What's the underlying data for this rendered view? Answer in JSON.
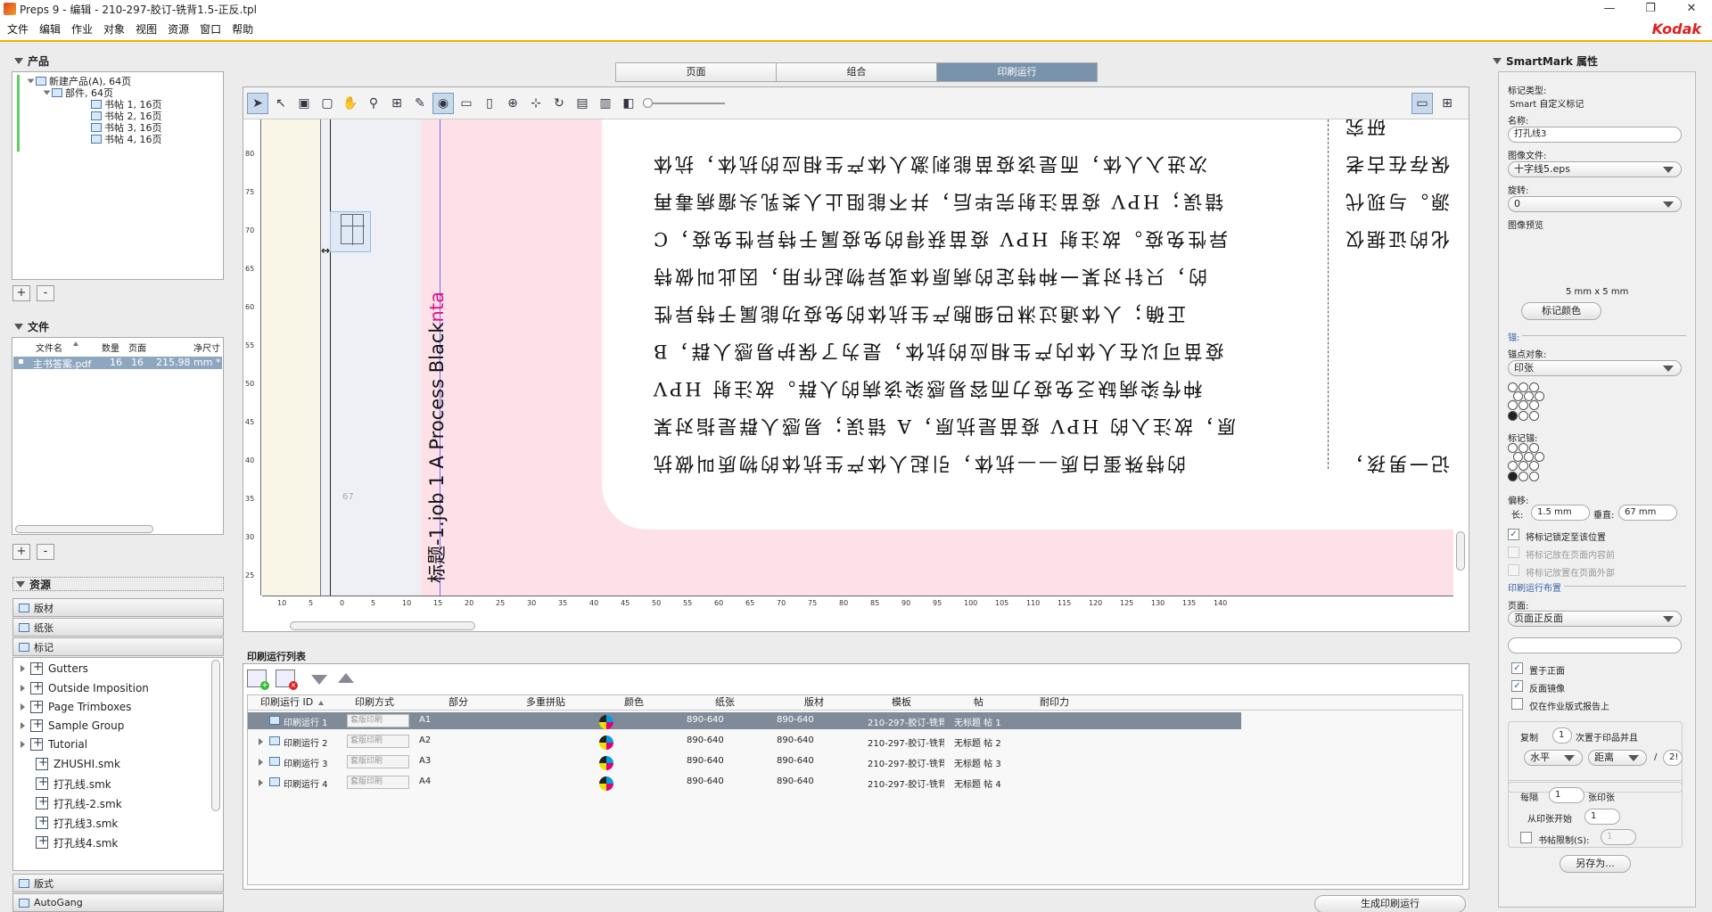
{
  "window": {
    "title": "Preps 9 - 编辑 - 210-297-胶订-铣背1.5-正反.tpl",
    "minimize": "—",
    "restore": "❐",
    "close": "✕"
  },
  "menu": [
    "文件",
    "编辑",
    "作业",
    "对象",
    "视图",
    "资源",
    "窗口",
    "帮助"
  ],
  "brand": "Kodak",
  "product_panel": {
    "title": "产品",
    "tree": [
      {
        "label": "新建产品(A), 64页",
        "level": 0
      },
      {
        "label": "部件, 64页",
        "level": 1
      },
      {
        "label": "书帖 1, 16页",
        "level": 2
      },
      {
        "label": "书帖 2, 16页",
        "level": 2
      },
      {
        "label": "书帖 3, 16页",
        "level": 2
      },
      {
        "label": "书帖 4, 16页",
        "level": 2
      }
    ],
    "add": "+",
    "remove": "-"
  },
  "files_panel": {
    "title": "文件",
    "columns": [
      "文件名",
      "数量",
      "页面",
      "净尺寸"
    ],
    "rows": [
      {
        "name": "主书答案.pdf",
        "qty": "16",
        "pages": "16",
        "size": "215.98 mm *"
      }
    ],
    "add": "+",
    "remove": "-"
  },
  "resources_panel": {
    "title": "资源",
    "sections": [
      "版材",
      "纸张",
      "标记"
    ],
    "marks": [
      "Gutters",
      "Outside Imposition",
      "Page Trimboxes",
      "Sample Group",
      "Tutorial",
      "ZHUSHI.smk",
      "打孔线.smk",
      "打孔线-2.smk",
      "打孔线3.smk",
      "打孔线4.smk"
    ],
    "bottom_sections": [
      "版式",
      "AutoGang"
    ]
  },
  "view_tabs": [
    "页面",
    "组合",
    "印刷运行"
  ],
  "view_tabs_active": 2,
  "canvas": {
    "process_text": "标题-1.job  1  A Process Black",
    "process_tail": "nta",
    "mark_label": "67",
    "cjk_lines": [
      "的特殊蛋白质——抗体，引起人体产生抗体的物质叫做抗",
      "原，故注入的 HPV 疫苗是抗原，A 错误；易感人群是指对某",
      "种传染病缺乏免疫力而容易感染该病的人群。故注射 HPV",
      "疫苗可以在人体内产生相应的抗体，是为了保护易感人群，B",
      "正确；人体通过淋巴细胞产生抗体的免疫功能属于特异性",
      "的，只针对某一种特定的病原体或异物起作用，因此叫做特",
      "异性免疫。故注射 HPV 疫苗获得的免疫属于特异性免疫，C",
      "错误；HPV 疫苗注射完毕后，并不能阻止人类乳头瘤病毒再",
      "次进入人体，而是该疫苗能刺激人体产生相应的抗体，抗体"
    ],
    "cjk_right": [
      "记一男孩，",
      "化的证据仅",
      "源。与现代",
      "保存在古老",
      "研究"
    ],
    "ruler_h": [
      "10",
      "5",
      "0",
      "5",
      "10",
      "15",
      "20",
      "25",
      "30",
      "35",
      "40",
      "45",
      "50",
      "55",
      "60",
      "65",
      "70",
      "75",
      "80",
      "85",
      "90",
      "95",
      "100",
      "105",
      "110",
      "115",
      "120",
      "125",
      "130",
      "135",
      "140"
    ],
    "ruler_v": [
      "80",
      "75",
      "70",
      "65",
      "60",
      "55",
      "50",
      "45",
      "40",
      "35",
      "30",
      "25"
    ]
  },
  "runlist": {
    "title": "印刷运行列表",
    "columns": [
      "印刷运行 ID",
      "印刷方式",
      "部分",
      "多重拼贴",
      "颜色",
      "纸张",
      "版材",
      "模板",
      "帖",
      "耐印力"
    ],
    "rows": [
      {
        "id": "印刷运行 1",
        "method": "套版印刷",
        "part": "A1",
        "paper": "890-640",
        "plate": "890-640",
        "template": "210-297-胶订-铣背",
        "sig": "无标题 帖 1",
        "selected": true
      },
      {
        "id": "印刷运行 2",
        "method": "套版印刷",
        "part": "A2",
        "paper": "890-640",
        "plate": "890-640",
        "template": "210-297-胶订-铣背",
        "sig": "无标题 帖 2",
        "selected": false
      },
      {
        "id": "印刷运行 3",
        "method": "套版印刷",
        "part": "A3",
        "paper": "890-640",
        "plate": "890-640",
        "template": "210-297-胶订-铣背",
        "sig": "无标题 帖 3",
        "selected": false
      },
      {
        "id": "印刷运行 4",
        "method": "套版印刷",
        "part": "A4",
        "paper": "890-640",
        "plate": "890-640",
        "template": "210-297-胶订-铣背",
        "sig": "无标题 帖 4",
        "selected": false
      }
    ],
    "generate_btn": "生成印刷运行"
  },
  "smartmark": {
    "title": "SmartMark 属性",
    "type_label": "标记类型:",
    "type_value": "Smart 自定义标记",
    "name_label": "名称:",
    "name_value": "打孔线3",
    "image_label": "图像文件:",
    "image_value": "十字线5.eps",
    "rotation_label": "旋转:",
    "rotation_value": "0",
    "preview_label": "图像预览",
    "size_text": "5 mm x 5 mm",
    "color_btn": "标记颜色",
    "anchor_section": "锚:",
    "anchor_obj_label": "锚点对象:",
    "anchor_obj_value": "印张",
    "mark_anchor_label": "标记锚:",
    "offset_label": "偏移:",
    "h_label": "长:",
    "h_value": "1.5 mm",
    "v_label": "垂直:",
    "v_value": "67 mm",
    "chk_lock": "将标记锁定至该位置",
    "chk_inside": "将标记放在页面内容前",
    "chk_outside": "将标记放置在页面外部",
    "layout_section": "印刷运行布置",
    "page_label": "页面:",
    "page_value": "页面正反面",
    "chk_front": "置于正面",
    "chk_mirror": "反面镜像",
    "chk_report": "仅在作业版式报告上",
    "copy_label": "复制",
    "copy_value": "1",
    "copy_suffix": "次置于印品并且",
    "horiz_value": "水平",
    "dist_value": "距离",
    "slash": "/",
    "dist_num": "2!",
    "every_label": "每隔",
    "every_value": "1",
    "every_suffix": "张印张",
    "from_label": "从印张开始",
    "from_value": "1",
    "sig_limit_label": "书帖限制(S):",
    "sig_limit_value": "1",
    "saveas_btn": "另存为..."
  }
}
